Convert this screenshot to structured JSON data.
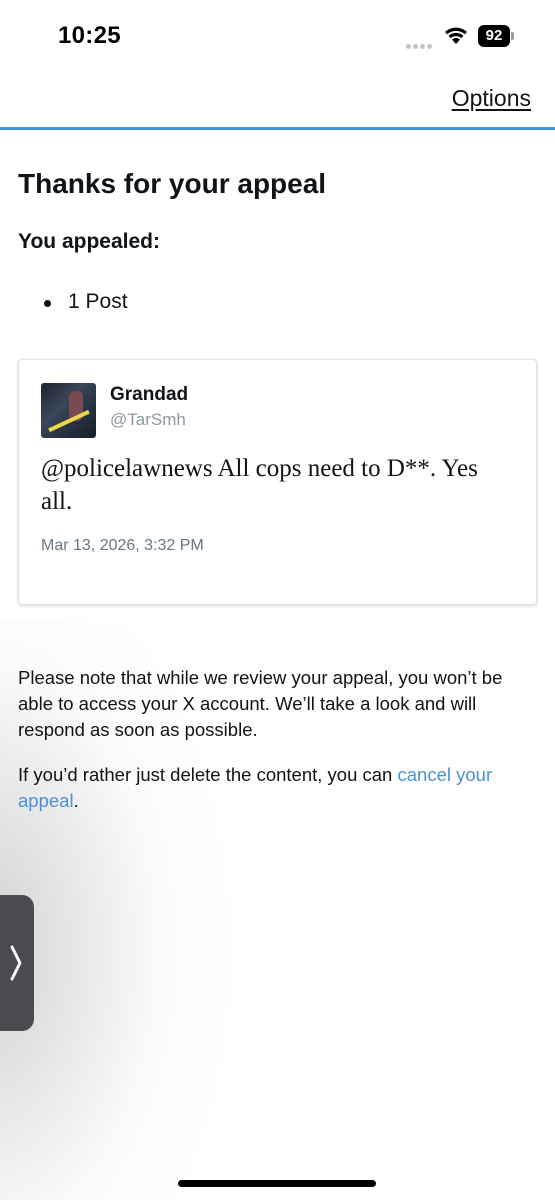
{
  "status_bar": {
    "time": "10:25",
    "battery": "92"
  },
  "nav": {
    "options_label": "Options"
  },
  "page": {
    "title": "Thanks for your appeal",
    "appealed_label": "You appealed:",
    "appealed_items": [
      "1 Post"
    ]
  },
  "tweet": {
    "display_name": "Grandad",
    "handle": "@TarSmh",
    "text": "@policelawnews All cops need to D**. Yes all.",
    "timestamp": "Mar 13, 2026, 3:32 PM"
  },
  "notes": {
    "review_note": "Please note that while we review your appeal, you won’t be able to access your X account. We’ll take a look and will respond as soon as possible.",
    "cancel_prefix": "If you’d rather just delete the content, you can ",
    "cancel_link": "cancel your appeal",
    "cancel_suffix": "."
  },
  "colors": {
    "accent": "#4a90d9",
    "text": "#0f1419",
    "muted": "#8899a6"
  }
}
